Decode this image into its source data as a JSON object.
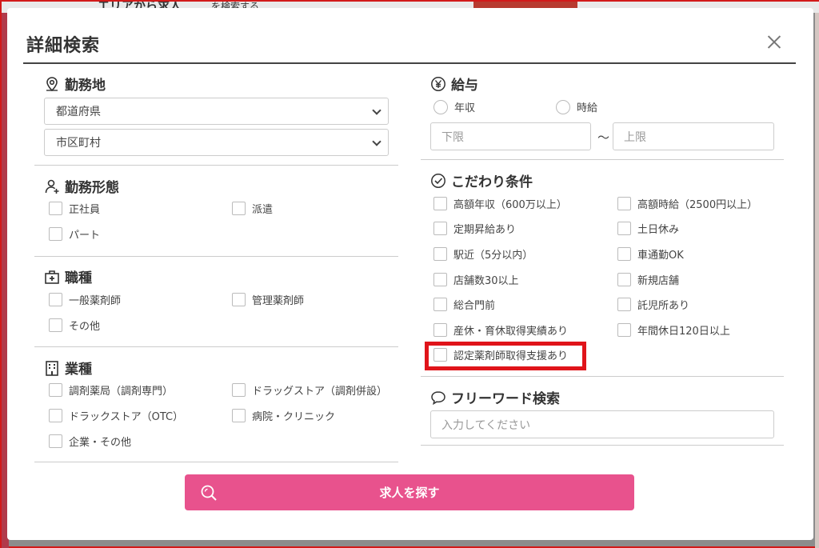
{
  "backdrop": {
    "heading": "エリアから求人",
    "heading_suffix": "を検索する"
  },
  "modal": {
    "title": "詳細検索",
    "close_label": "×"
  },
  "location": {
    "title": "勤務地",
    "icon": "map-pin-icon",
    "prefecture_placeholder": "都道府県",
    "city_placeholder": "市区町村"
  },
  "employment": {
    "title": "勤務形態",
    "icon": "person-icon",
    "options": [
      "正社員",
      "派遣",
      "パート"
    ]
  },
  "job_type": {
    "title": "職種",
    "icon": "medical-case-icon",
    "options": [
      "一般薬剤師",
      "管理薬剤師",
      "その他"
    ]
  },
  "industry": {
    "title": "業種",
    "icon": "building-icon",
    "options": [
      "調剤薬局（調剤専門）",
      "ドラッグストア（調剤併設）",
      "ドラックストア（OTC）",
      "病院・クリニック",
      "企業・その他"
    ]
  },
  "salary": {
    "title": "給与",
    "icon": "yen-icon",
    "radio_annual": "年収",
    "radio_hourly": "時給",
    "min_placeholder": "下限",
    "max_placeholder": "上限",
    "separator": "～"
  },
  "conditions": {
    "title": "こだわり条件",
    "icon": "check-circle-icon",
    "options": [
      "高額年収（600万以上）",
      "高額時給（2500円以上）",
      "定期昇給あり",
      "土日休み",
      "駅近（5分以内）",
      "車通勤OK",
      "店舗数30以上",
      "新規店舗",
      "総合門前",
      "託児所あり",
      "産休・育休取得実績あり",
      "年間休日120日以上",
      "認定薬剤師取得支援あり"
    ]
  },
  "freeword": {
    "title": "フリーワード検索",
    "icon": "speech-bubble-icon",
    "placeholder": "入力してください"
  },
  "submit": {
    "label": "求人を探す",
    "icon": "search-icon",
    "color": "#e8528d"
  },
  "highlight_color": "#e0141a"
}
